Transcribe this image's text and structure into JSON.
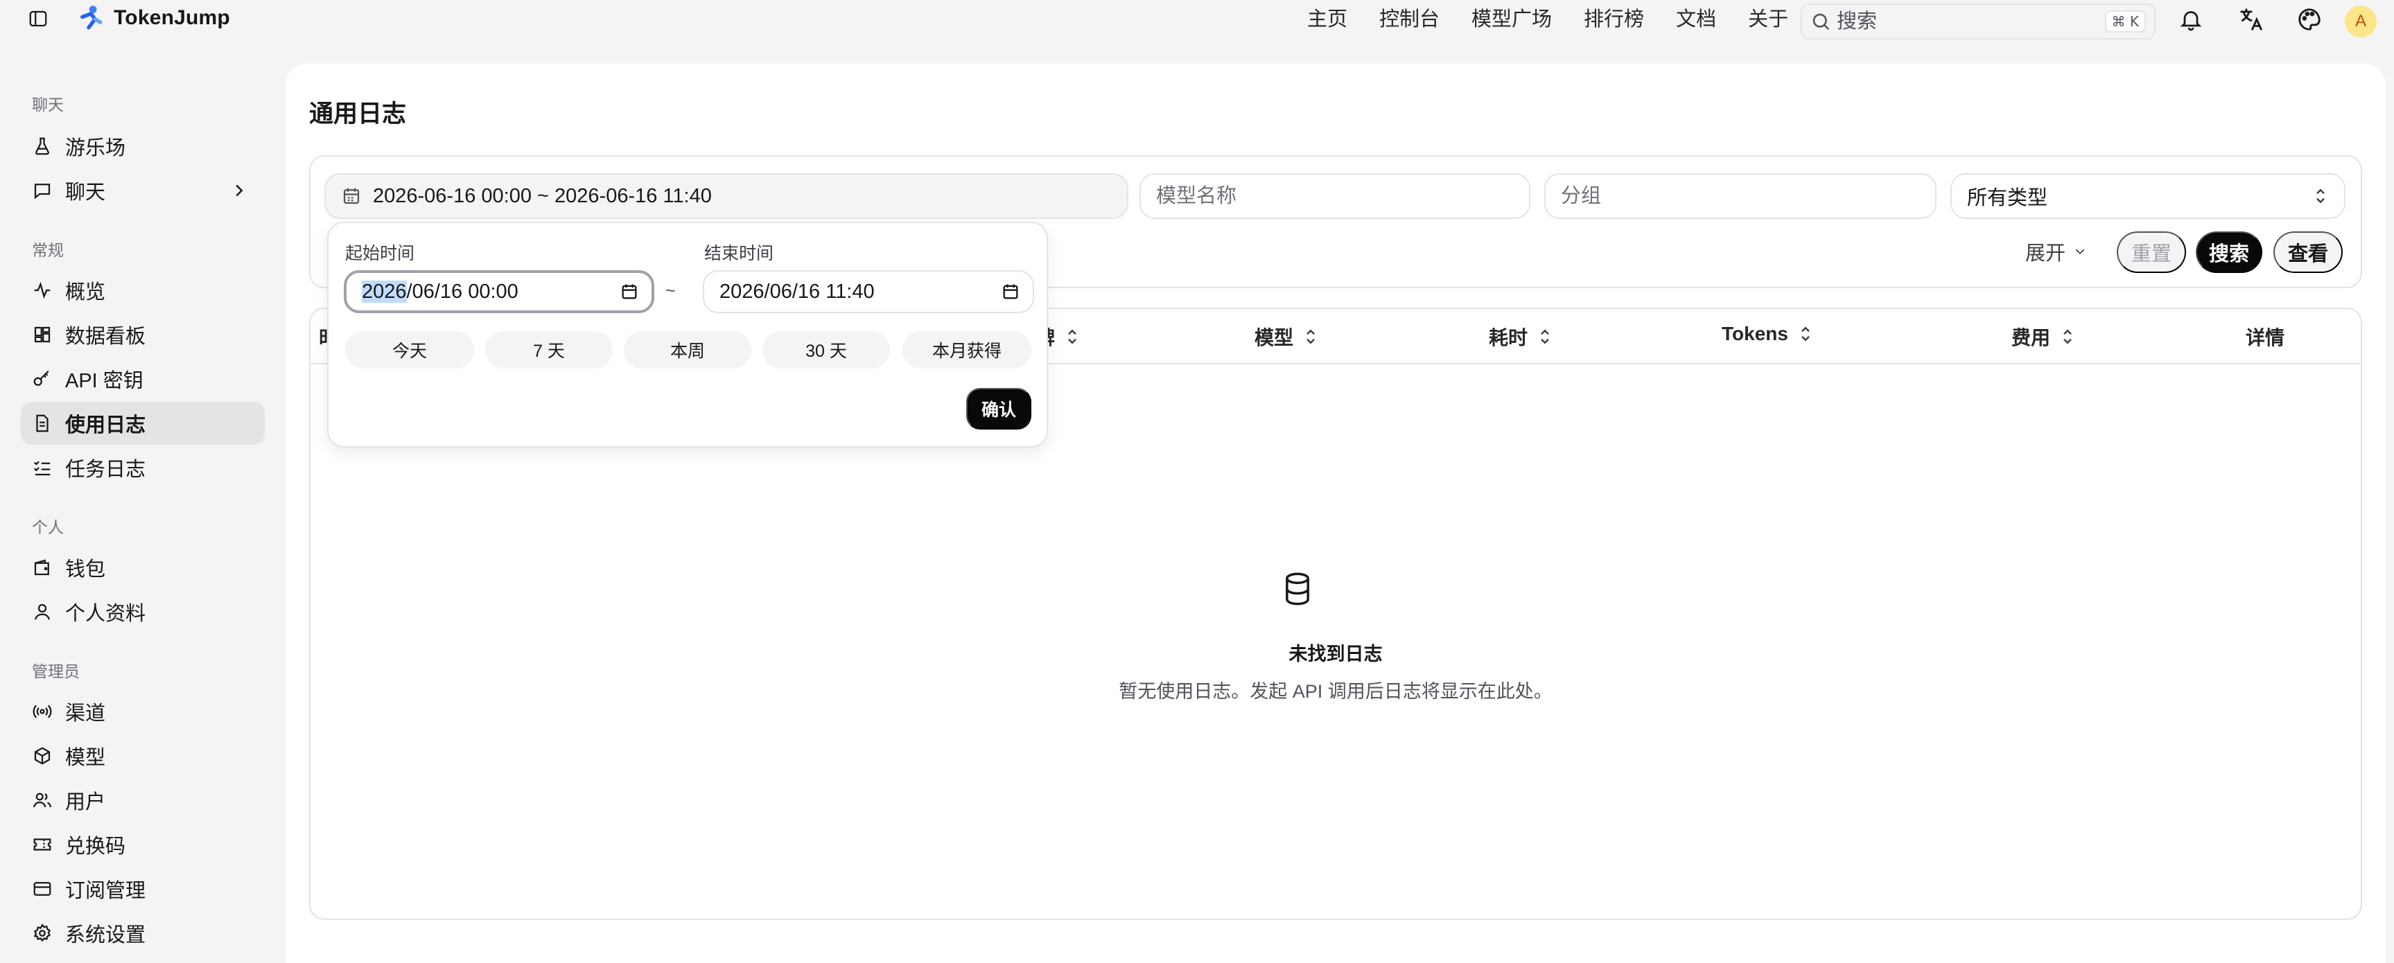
{
  "brand": {
    "name": "TokenJump"
  },
  "topnav": [
    "主页",
    "控制台",
    "模型广场",
    "排行榜",
    "文档",
    "关于"
  ],
  "search": {
    "placeholder": "搜索",
    "shortcut": "⌘ K"
  },
  "user": {
    "avatar_letter": "A"
  },
  "sidebar": {
    "groups": [
      {
        "label": "聊天",
        "items": [
          {
            "label": "游乐场",
            "icon": "flask-icon"
          },
          {
            "label": "聊天",
            "icon": "message-icon"
          }
        ]
      },
      {
        "label": "常规",
        "items": [
          {
            "label": "概览",
            "icon": "activity-icon"
          },
          {
            "label": "数据看板",
            "icon": "dashboard-icon"
          },
          {
            "label": "API 密钥",
            "icon": "key-icon"
          },
          {
            "label": "使用日志",
            "icon": "file-text-icon",
            "active": true
          },
          {
            "label": "任务日志",
            "icon": "list-check-icon"
          }
        ]
      },
      {
        "label": "个人",
        "items": [
          {
            "label": "钱包",
            "icon": "wallet-icon"
          },
          {
            "label": "个人资料",
            "icon": "user-icon"
          }
        ]
      },
      {
        "label": "管理员",
        "items": [
          {
            "label": "渠道",
            "icon": "radio-icon"
          },
          {
            "label": "模型",
            "icon": "box-icon"
          },
          {
            "label": "用户",
            "icon": "users-icon"
          },
          {
            "label": "兑换码",
            "icon": "ticket-icon"
          },
          {
            "label": "订阅管理",
            "icon": "credit-card-icon"
          },
          {
            "label": "系统设置",
            "icon": "gear-icon"
          }
        ]
      }
    ]
  },
  "page": {
    "title": "通用日志"
  },
  "filters": {
    "date_range": "2026-06-16 00:00 ~ 2026-06-16 11:40",
    "model_placeholder": "模型名称",
    "group_placeholder": "分组",
    "type_value": "所有类型",
    "expand_label": "展开",
    "reset_label": "重置",
    "search_label": "搜索",
    "view_label": "查看"
  },
  "table": {
    "columns": [
      "时",
      "牌",
      "模型",
      "耗时",
      "Tokens",
      "费用",
      "详情"
    ],
    "empty_title": "未找到日志",
    "empty_desc": "暂无使用日志。发起 API 调用后日志将显示在此处。"
  },
  "date_picker": {
    "start_label": "起始时间",
    "end_label": "结束时间",
    "start_year": "2026",
    "start_rest": "/06/16  00:00",
    "end_value": "2026/06/16  11:40",
    "separator": "~",
    "quick_ranges": [
      "今天",
      "7 天",
      "本周",
      "30 天",
      "本月获得"
    ],
    "confirm_label": "确认"
  }
}
